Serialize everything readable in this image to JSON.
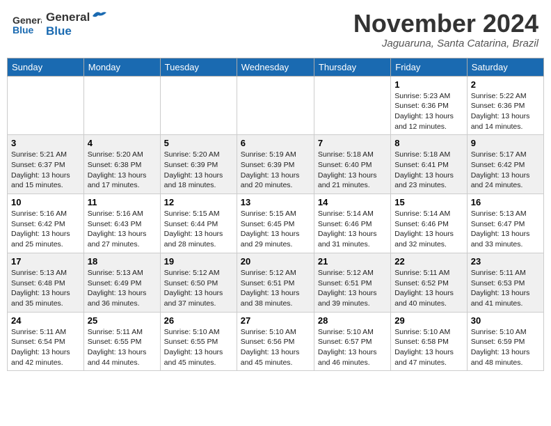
{
  "header": {
    "logo_line1": "General",
    "logo_line2": "Blue",
    "month": "November 2024",
    "location": "Jaguaruna, Santa Catarina, Brazil"
  },
  "days_of_week": [
    "Sunday",
    "Monday",
    "Tuesday",
    "Wednesday",
    "Thursday",
    "Friday",
    "Saturday"
  ],
  "weeks": [
    [
      {
        "day": "",
        "info": ""
      },
      {
        "day": "",
        "info": ""
      },
      {
        "day": "",
        "info": ""
      },
      {
        "day": "",
        "info": ""
      },
      {
        "day": "",
        "info": ""
      },
      {
        "day": "1",
        "info": "Sunrise: 5:23 AM\nSunset: 6:36 PM\nDaylight: 13 hours\nand 12 minutes."
      },
      {
        "day": "2",
        "info": "Sunrise: 5:22 AM\nSunset: 6:36 PM\nDaylight: 13 hours\nand 14 minutes."
      }
    ],
    [
      {
        "day": "3",
        "info": "Sunrise: 5:21 AM\nSunset: 6:37 PM\nDaylight: 13 hours\nand 15 minutes."
      },
      {
        "day": "4",
        "info": "Sunrise: 5:20 AM\nSunset: 6:38 PM\nDaylight: 13 hours\nand 17 minutes."
      },
      {
        "day": "5",
        "info": "Sunrise: 5:20 AM\nSunset: 6:39 PM\nDaylight: 13 hours\nand 18 minutes."
      },
      {
        "day": "6",
        "info": "Sunrise: 5:19 AM\nSunset: 6:39 PM\nDaylight: 13 hours\nand 20 minutes."
      },
      {
        "day": "7",
        "info": "Sunrise: 5:18 AM\nSunset: 6:40 PM\nDaylight: 13 hours\nand 21 minutes."
      },
      {
        "day": "8",
        "info": "Sunrise: 5:18 AM\nSunset: 6:41 PM\nDaylight: 13 hours\nand 23 minutes."
      },
      {
        "day": "9",
        "info": "Sunrise: 5:17 AM\nSunset: 6:42 PM\nDaylight: 13 hours\nand 24 minutes."
      }
    ],
    [
      {
        "day": "10",
        "info": "Sunrise: 5:16 AM\nSunset: 6:42 PM\nDaylight: 13 hours\nand 25 minutes."
      },
      {
        "day": "11",
        "info": "Sunrise: 5:16 AM\nSunset: 6:43 PM\nDaylight: 13 hours\nand 27 minutes."
      },
      {
        "day": "12",
        "info": "Sunrise: 5:15 AM\nSunset: 6:44 PM\nDaylight: 13 hours\nand 28 minutes."
      },
      {
        "day": "13",
        "info": "Sunrise: 5:15 AM\nSunset: 6:45 PM\nDaylight: 13 hours\nand 29 minutes."
      },
      {
        "day": "14",
        "info": "Sunrise: 5:14 AM\nSunset: 6:46 PM\nDaylight: 13 hours\nand 31 minutes."
      },
      {
        "day": "15",
        "info": "Sunrise: 5:14 AM\nSunset: 6:46 PM\nDaylight: 13 hours\nand 32 minutes."
      },
      {
        "day": "16",
        "info": "Sunrise: 5:13 AM\nSunset: 6:47 PM\nDaylight: 13 hours\nand 33 minutes."
      }
    ],
    [
      {
        "day": "17",
        "info": "Sunrise: 5:13 AM\nSunset: 6:48 PM\nDaylight: 13 hours\nand 35 minutes."
      },
      {
        "day": "18",
        "info": "Sunrise: 5:13 AM\nSunset: 6:49 PM\nDaylight: 13 hours\nand 36 minutes."
      },
      {
        "day": "19",
        "info": "Sunrise: 5:12 AM\nSunset: 6:50 PM\nDaylight: 13 hours\nand 37 minutes."
      },
      {
        "day": "20",
        "info": "Sunrise: 5:12 AM\nSunset: 6:51 PM\nDaylight: 13 hours\nand 38 minutes."
      },
      {
        "day": "21",
        "info": "Sunrise: 5:12 AM\nSunset: 6:51 PM\nDaylight: 13 hours\nand 39 minutes."
      },
      {
        "day": "22",
        "info": "Sunrise: 5:11 AM\nSunset: 6:52 PM\nDaylight: 13 hours\nand 40 minutes."
      },
      {
        "day": "23",
        "info": "Sunrise: 5:11 AM\nSunset: 6:53 PM\nDaylight: 13 hours\nand 41 minutes."
      }
    ],
    [
      {
        "day": "24",
        "info": "Sunrise: 5:11 AM\nSunset: 6:54 PM\nDaylight: 13 hours\nand 42 minutes."
      },
      {
        "day": "25",
        "info": "Sunrise: 5:11 AM\nSunset: 6:55 PM\nDaylight: 13 hours\nand 44 minutes."
      },
      {
        "day": "26",
        "info": "Sunrise: 5:10 AM\nSunset: 6:55 PM\nDaylight: 13 hours\nand 45 minutes."
      },
      {
        "day": "27",
        "info": "Sunrise: 5:10 AM\nSunset: 6:56 PM\nDaylight: 13 hours\nand 45 minutes."
      },
      {
        "day": "28",
        "info": "Sunrise: 5:10 AM\nSunset: 6:57 PM\nDaylight: 13 hours\nand 46 minutes."
      },
      {
        "day": "29",
        "info": "Sunrise: 5:10 AM\nSunset: 6:58 PM\nDaylight: 13 hours\nand 47 minutes."
      },
      {
        "day": "30",
        "info": "Sunrise: 5:10 AM\nSunset: 6:59 PM\nDaylight: 13 hours\nand 48 minutes."
      }
    ]
  ]
}
